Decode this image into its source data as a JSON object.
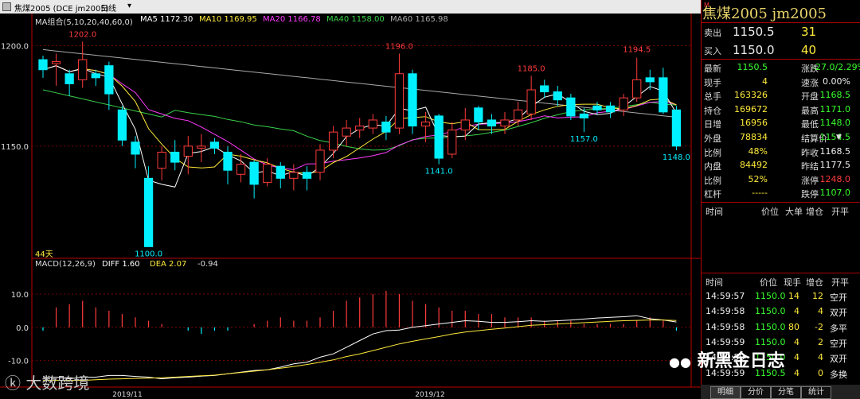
{
  "window": {
    "title": "焦煤2005 (DCE jm2005)",
    "period": "日线",
    "controls": [
      "▲",
      "▼",
      "■",
      "✕"
    ]
  },
  "ma_legend": {
    "group": "MA组合(5,10,20,40,60,0)",
    "ma5": "MA5 1172.30",
    "ma10": "MA10 1169.95",
    "ma20": "MA20 1166.78",
    "ma40": "MA40 1158.00",
    "ma60": "MA60 1165.98"
  },
  "macd_legend": {
    "name": "MACD(12,26,9)",
    "diff": "DIFF 1.60",
    "dea": "DEA 2.07",
    "macd": "-0.94"
  },
  "price_axis": [
    "1200.0",
    "1150.0"
  ],
  "macd_axis": [
    "10.0",
    "0.0",
    "-10.0"
  ],
  "date_axis": [
    "2019/11",
    "2019/12"
  ],
  "days_label": "44天",
  "annotations": [
    "1202.0",
    "1196.0",
    "1185.0",
    "1194.5",
    "1141.0",
    "1157.0",
    "1148.0",
    "1100.0"
  ],
  "colors": {
    "up": "#ff3b3b",
    "down": "#00f0ff",
    "ma5": "#ffffff",
    "ma10": "#ffea3b",
    "ma20": "#ff3cff",
    "ma40": "#39d14a",
    "ma60": "#aaaaaa"
  },
  "chart_data": {
    "type": "candlestick",
    "ylim": [
      1095,
      1212
    ],
    "candles": [
      {
        "o": 1193,
        "c": 1188,
        "h": 1195,
        "l": 1184
      },
      {
        "o": 1191,
        "c": 1192,
        "h": 1196,
        "l": 1180
      },
      {
        "o": 1186,
        "c": 1181,
        "h": 1188,
        "l": 1175
      },
      {
        "o": 1183,
        "c": 1193,
        "h": 1202,
        "l": 1179
      },
      {
        "o": 1186,
        "c": 1184,
        "h": 1188,
        "l": 1180
      },
      {
        "o": 1190,
        "c": 1176,
        "h": 1192,
        "l": 1168
      },
      {
        "o": 1168,
        "c": 1153,
        "h": 1170,
        "l": 1150
      },
      {
        "o": 1152,
        "c": 1146,
        "h": 1155,
        "l": 1139
      },
      {
        "o": 1134,
        "c": 1100,
        "h": 1140,
        "l": 1100
      },
      {
        "o": 1139,
        "c": 1147,
        "h": 1150,
        "l": 1133
      },
      {
        "o": 1147,
        "c": 1142,
        "h": 1153,
        "l": 1138
      },
      {
        "o": 1145,
        "c": 1150,
        "h": 1155,
        "l": 1136
      },
      {
        "o": 1149,
        "c": 1150,
        "h": 1156,
        "l": 1142
      },
      {
        "o": 1152,
        "c": 1149,
        "h": 1154,
        "l": 1146
      },
      {
        "o": 1147,
        "c": 1138,
        "h": 1150,
        "l": 1131
      },
      {
        "o": 1136,
        "c": 1141,
        "h": 1146,
        "l": 1132
      },
      {
        "o": 1142,
        "c": 1131,
        "h": 1143,
        "l": 1124
      },
      {
        "o": 1132,
        "c": 1141,
        "h": 1144,
        "l": 1130
      },
      {
        "o": 1140,
        "c": 1134,
        "h": 1142,
        "l": 1129
      },
      {
        "o": 1134,
        "c": 1137,
        "h": 1141,
        "l": 1128
      },
      {
        "o": 1137,
        "c": 1134,
        "h": 1140,
        "l": 1128
      },
      {
        "o": 1137,
        "c": 1148,
        "h": 1151,
        "l": 1133
      },
      {
        "o": 1148,
        "c": 1157,
        "h": 1160,
        "l": 1144
      },
      {
        "o": 1155,
        "c": 1159,
        "h": 1163,
        "l": 1150
      },
      {
        "o": 1158,
        "c": 1160,
        "h": 1164,
        "l": 1154
      },
      {
        "o": 1159,
        "c": 1163,
        "h": 1166,
        "l": 1156
      },
      {
        "o": 1162,
        "c": 1157,
        "h": 1165,
        "l": 1153
      },
      {
        "o": 1159,
        "c": 1186,
        "h": 1196,
        "l": 1156
      },
      {
        "o": 1186,
        "c": 1160,
        "h": 1188,
        "l": 1156
      },
      {
        "o": 1160,
        "c": 1162,
        "h": 1167,
        "l": 1152
      },
      {
        "o": 1165,
        "c": 1144,
        "h": 1166,
        "l": 1141
      },
      {
        "o": 1146,
        "c": 1158,
        "h": 1162,
        "l": 1144
      },
      {
        "o": 1158,
        "c": 1163,
        "h": 1169,
        "l": 1153
      },
      {
        "o": 1169,
        "c": 1162,
        "h": 1170,
        "l": 1158
      },
      {
        "o": 1163,
        "c": 1160,
        "h": 1166,
        "l": 1156
      },
      {
        "o": 1160,
        "c": 1163,
        "h": 1167,
        "l": 1156
      },
      {
        "o": 1163,
        "c": 1168,
        "h": 1172,
        "l": 1160
      },
      {
        "o": 1166,
        "c": 1178,
        "h": 1185,
        "l": 1163
      },
      {
        "o": 1180,
        "c": 1177,
        "h": 1183,
        "l": 1174
      },
      {
        "o": 1177,
        "c": 1173,
        "h": 1180,
        "l": 1170
      },
      {
        "o": 1174,
        "c": 1165,
        "h": 1176,
        "l": 1163
      },
      {
        "o": 1166,
        "c": 1164,
        "h": 1169,
        "l": 1157
      },
      {
        "o": 1170,
        "c": 1168,
        "h": 1172,
        "l": 1166
      },
      {
        "o": 1170,
        "c": 1167,
        "h": 1172,
        "l": 1164
      },
      {
        "o": 1168,
        "c": 1174,
        "h": 1176,
        "l": 1165
      },
      {
        "o": 1174,
        "c": 1183,
        "h": 1194,
        "l": 1172
      },
      {
        "o": 1184,
        "c": 1182,
        "h": 1188,
        "l": 1178
      },
      {
        "o": 1184,
        "c": 1167,
        "h": 1189,
        "l": 1166
      },
      {
        "o": 1168,
        "c": 1150,
        "h": 1170,
        "l": 1148
      }
    ],
    "macd": {
      "ylim": [
        -18,
        16
      ],
      "hist": [
        -1,
        6,
        7,
        8,
        6,
        5,
        4,
        3,
        2,
        1,
        0,
        -1,
        -2,
        -1,
        -1,
        0,
        1,
        2,
        3,
        2,
        2,
        3,
        5,
        8,
        9,
        10,
        11,
        10,
        8,
        7,
        6,
        5,
        5,
        4,
        4,
        3,
        3,
        3,
        2,
        2,
        2,
        1,
        1,
        1,
        1,
        2,
        3,
        2,
        -1
      ],
      "diff": [
        -15,
        -15,
        -15.5,
        -15,
        -15,
        -14.5,
        -14.5,
        -14.8,
        -15,
        -15.5,
        -15.2,
        -15,
        -14.7,
        -14.5,
        -14,
        -13.5,
        -13,
        -12.8,
        -12,
        -11,
        -10.5,
        -9,
        -8,
        -6,
        -4,
        -2,
        -1,
        -0.8,
        0,
        0.5,
        1,
        1.5,
        2,
        1.8,
        1.5,
        1.5,
        1.7,
        2,
        1.8,
        2,
        2.2,
        2.5,
        2.8,
        3,
        3.2,
        3.5,
        2.6,
        2.2,
        1.6
      ],
      "dea": [
        -16,
        -16,
        -16,
        -16,
        -15.8,
        -15.6,
        -15.5,
        -15.4,
        -15.3,
        -15.2,
        -15,
        -14.8,
        -14.6,
        -14.4,
        -14,
        -13.6,
        -13.2,
        -12.8,
        -12.3,
        -11.8,
        -11.2,
        -10.5,
        -9.8,
        -8.8,
        -8,
        -7,
        -6,
        -5,
        -4.2,
        -3.5,
        -2.8,
        -2,
        -1.4,
        -1,
        -0.6,
        -0.2,
        0.2,
        0.6,
        0.8,
        1,
        1.2,
        1.4,
        1.6,
        1.8,
        2,
        2.1,
        2.2,
        2.2,
        2.07
      ]
    }
  },
  "quote": {
    "title": "焦煤2005  jm2005",
    "sell_label": "卖出",
    "sell_price": "1150.5",
    "sell_vol": "31",
    "buy_label": "买入",
    "buy_price": "1150.0",
    "buy_vol": "40",
    "rows": [
      {
        "l1": "最新",
        "v1": "1150.5",
        "c1": "g",
        "l2": "涨跌",
        "v2": "-27.0/2.29%",
        "c2": "g"
      },
      {
        "l1": "现手",
        "v1": "4",
        "c1": "y",
        "l2": "速涨",
        "v2": "0.00%",
        "c2": "w"
      },
      {
        "l1": "总手",
        "v1": "163326",
        "c1": "y",
        "l2": "开盘",
        "v2": "1168.5",
        "c2": "g"
      },
      {
        "l1": "持仓",
        "v1": "169672",
        "c1": "y",
        "l2": "最高",
        "v2": "1171.0",
        "c2": "g"
      },
      {
        "l1": "日增",
        "v1": "16956",
        "c1": "y",
        "l2": "最低",
        "v2": "1148.0",
        "c2": "g"
      },
      {
        "l1": "外盘",
        "v1": "78834",
        "c1": "y",
        "l2": "结算价",
        "v2": "1154.5",
        "c2": "g"
      },
      {
        "l1": "比例",
        "v1": "48%",
        "c1": "y",
        "l2": "昨收",
        "v2": "1168.5",
        "c2": "w"
      },
      {
        "l1": "内盘",
        "v1": "84492",
        "c1": "y",
        "l2": "昨结",
        "v2": "1177.5",
        "c2": "w"
      },
      {
        "l1": "比例",
        "v1": "52%",
        "c1": "y",
        "l2": "涨停",
        "v2": "1248.0",
        "c2": "r"
      },
      {
        "l1": "杠杆",
        "v1": "-----",
        "c1": "y",
        "l2": "跌停",
        "v2": "1107.0",
        "c2": "g"
      }
    ],
    "settle_arrow": "▼"
  },
  "ticks_header": {
    "time": "时间",
    "price": "价位",
    "size": "大单",
    "oi": "增仓",
    "oc": "开平"
  },
  "trades_header": {
    "time": "时间",
    "price": "价位",
    "qty": "现手",
    "oi": "增仓",
    "oc": "开平"
  },
  "trades": [
    {
      "t": "14:59:57",
      "p": "1150.0",
      "q": "14",
      "oi": "12",
      "oc": "空开"
    },
    {
      "t": "14:59:58",
      "p": "1150.0",
      "q": "4",
      "oi": "4",
      "oc": "双开"
    },
    {
      "t": "14:59:58",
      "p": "1150.0",
      "q": "80",
      "oi": "-2",
      "oc": "多平"
    },
    {
      "t": "14:59:59",
      "p": "1150.0",
      "q": "4",
      "oi": "2",
      "oc": "空开"
    },
    {
      "t": "14:59:59",
      "p": "1150.0",
      "q": "4",
      "oi": "4",
      "oc": "双开"
    },
    {
      "t": "14:59:59",
      "p": "1150.5",
      "q": "4",
      "oi": "0",
      "oc": "多换"
    }
  ],
  "tabs": [
    "明细",
    "分价",
    "分笔",
    "统计"
  ],
  "watermark": "新黑金日志",
  "watermark2": "大数跨境"
}
